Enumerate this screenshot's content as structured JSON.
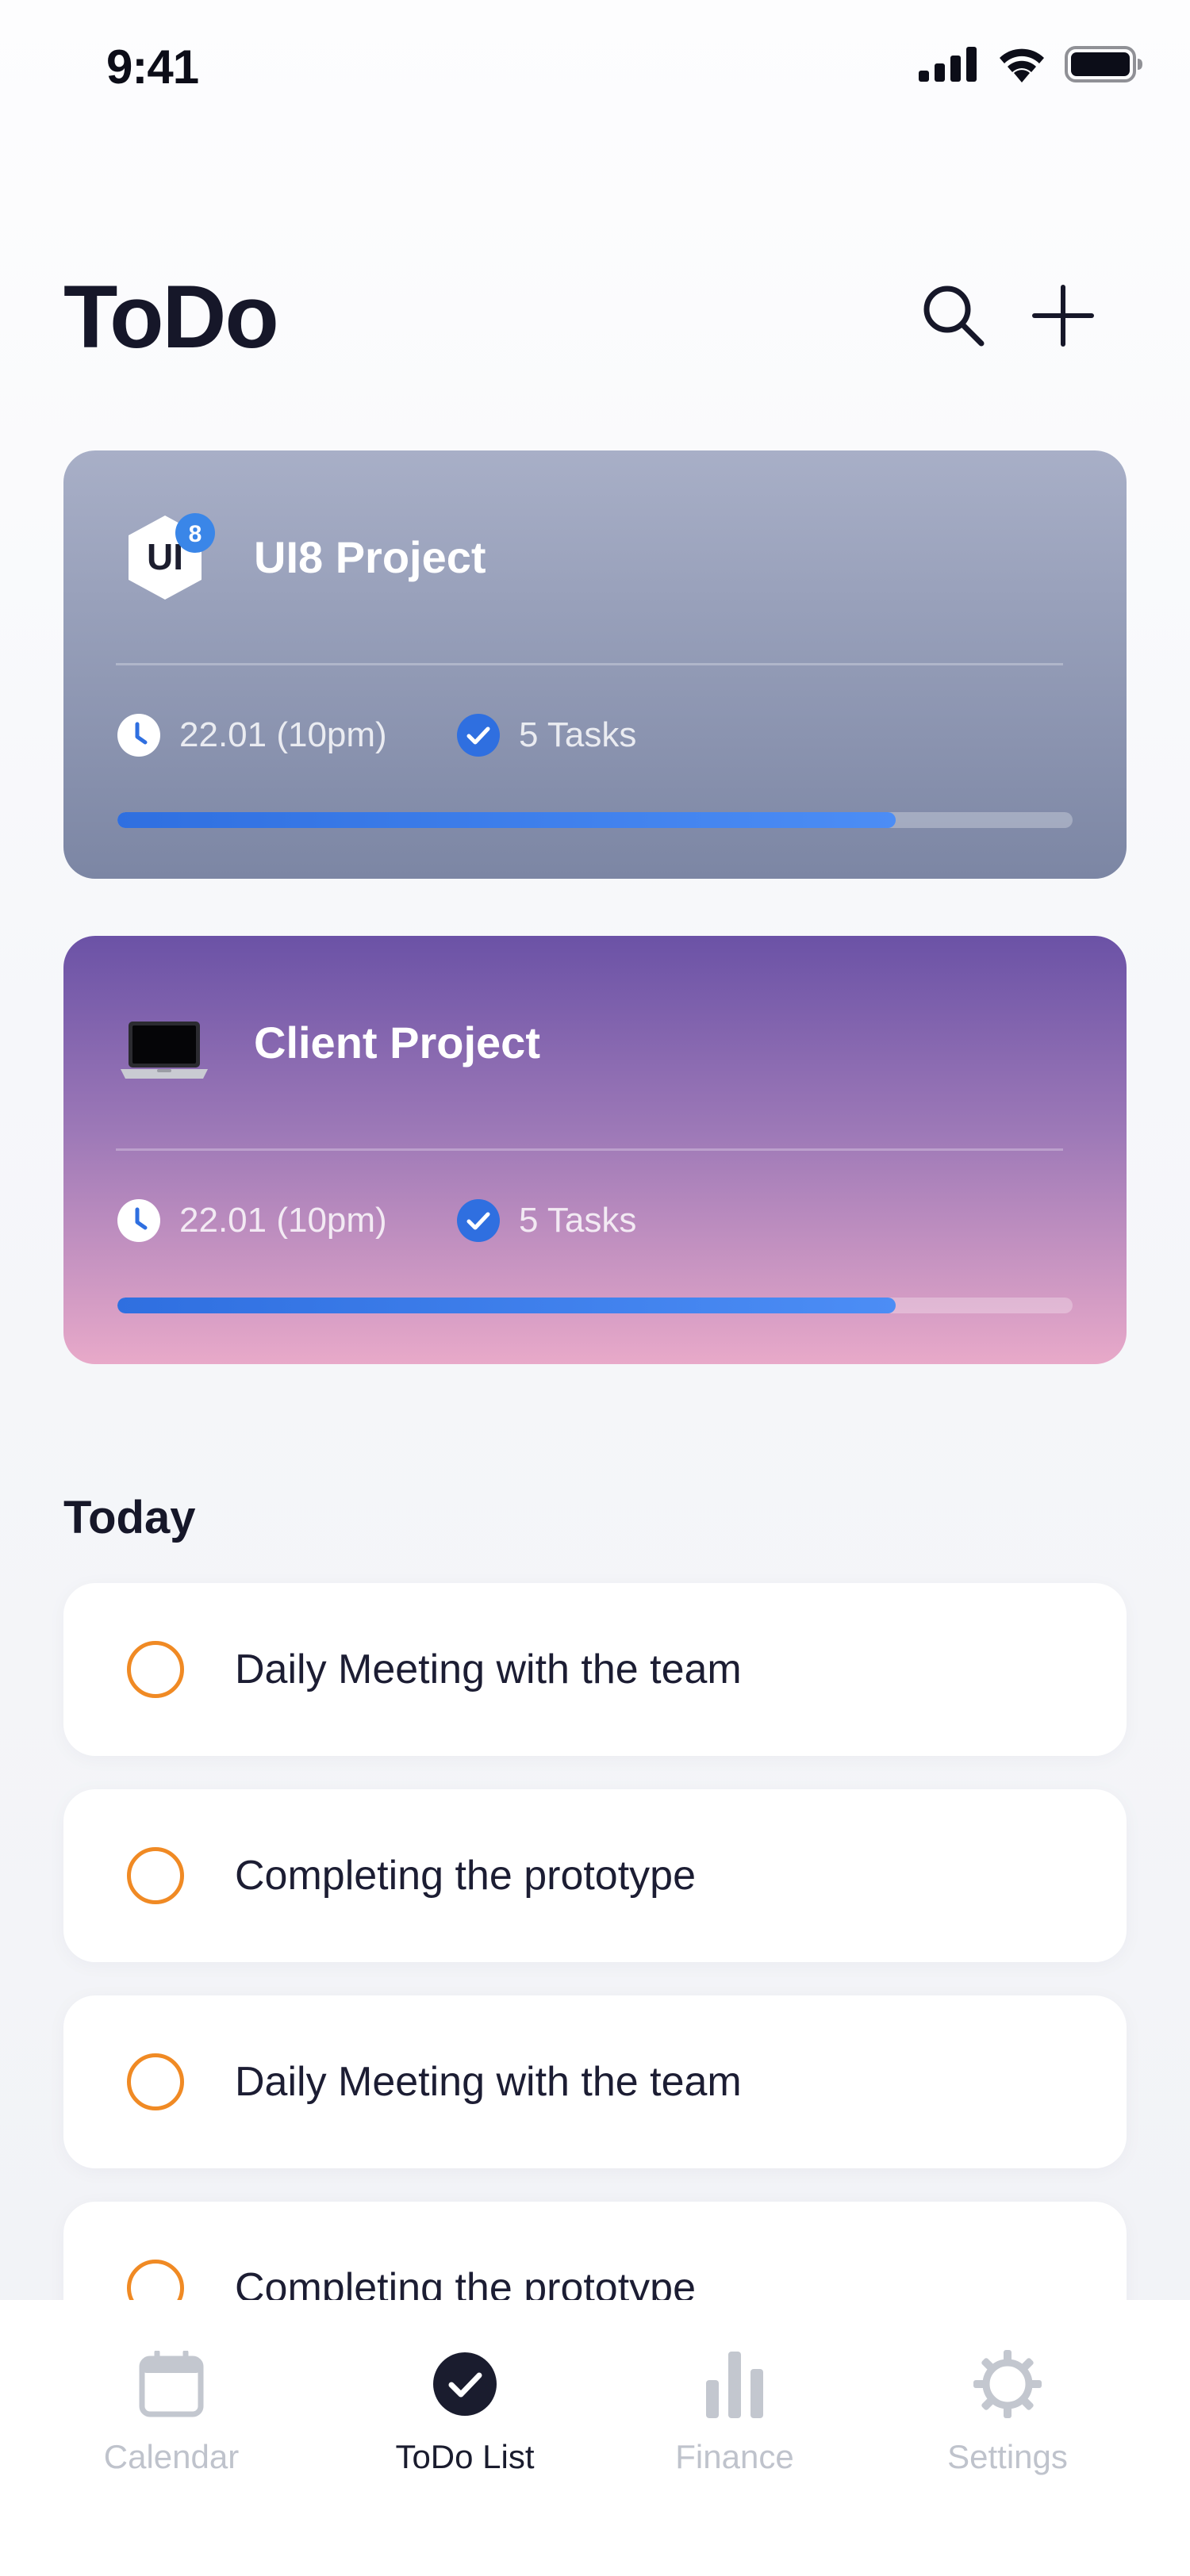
{
  "status_bar": {
    "time": "9:41"
  },
  "header": {
    "title": "ToDo"
  },
  "projects": [
    {
      "title": "UI8 Project",
      "logo_text": "UI",
      "badge": "8",
      "date": "22.01 (10pm)",
      "tasks": "5 Tasks",
      "progress": 0.815
    },
    {
      "title": "Client Project",
      "logo": "laptop-icon",
      "date": "22.01 (10pm)",
      "tasks": "5 Tasks",
      "progress": 0.815
    }
  ],
  "today": {
    "title": "Today",
    "tasks": [
      "Daily Meeting with the team",
      "Completing the prototype",
      "Daily Meeting with the team",
      "Completing the prototype"
    ]
  },
  "tabs": [
    {
      "label": "Calendar",
      "icon": "calendar-icon",
      "active": false
    },
    {
      "label": "ToDo List",
      "icon": "check-circle-icon",
      "active": true
    },
    {
      "label": "Finance",
      "icon": "bar-chart-icon",
      "active": false
    },
    {
      "label": "Settings",
      "icon": "gear-icon",
      "active": false
    }
  ],
  "colors": {
    "accent": "#2f6fe0",
    "task_ring": "#f08a24",
    "title": "#161729",
    "tab_inactive": "#bfc3cc"
  }
}
